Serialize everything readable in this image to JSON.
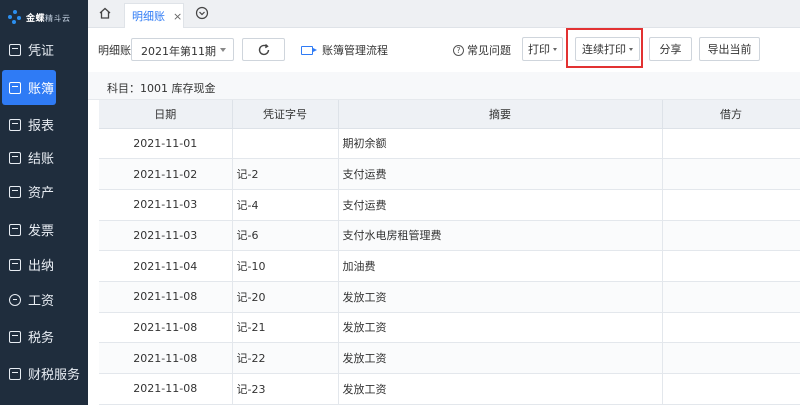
{
  "logo": {
    "name": "金蝶",
    "suffix": "精斗云"
  },
  "sidebar": {
    "items": [
      {
        "label": "凭证",
        "icon": "voucher-icon"
      },
      {
        "label": "账簿",
        "icon": "ledger-icon",
        "active": true
      },
      {
        "label": "报表",
        "icon": "report-icon"
      },
      {
        "label": "结账",
        "icon": "closing-icon"
      },
      {
        "label": "资产",
        "icon": "asset-icon"
      },
      {
        "label": "发票",
        "icon": "invoice-icon"
      },
      {
        "label": "出纳",
        "icon": "cashier-icon"
      },
      {
        "label": "工资",
        "icon": "salary-icon"
      },
      {
        "label": "税务",
        "icon": "tax-icon"
      },
      {
        "label": "财税服务",
        "icon": "service-icon"
      }
    ]
  },
  "tabs": {
    "active_label": "明细账",
    "close": "×"
  },
  "toolbar": {
    "ledger_label": "明细账",
    "period_value": "2021年第11期",
    "flow_link": "账簿管理流程",
    "faq_link": "常见问题",
    "print": "打印",
    "continuous_print": "连续打印",
    "share": "分享",
    "export_current": "导出当前"
  },
  "subject": {
    "text": "科目：1001 库存现金"
  },
  "table": {
    "headers": [
      "日期",
      "凭证字号",
      "摘要",
      "借方"
    ],
    "rows": [
      {
        "date": "2021-11-01",
        "voucher": "",
        "summary": "期初余额",
        "debit": ""
      },
      {
        "date": "2021-11-02",
        "voucher": "记-2",
        "summary": "支付运费",
        "debit": ""
      },
      {
        "date": "2021-11-03",
        "voucher": "记-4",
        "summary": "支付运费",
        "debit": ""
      },
      {
        "date": "2021-11-03",
        "voucher": "记-6",
        "summary": "支付水电房租管理费",
        "debit": ""
      },
      {
        "date": "2021-11-04",
        "voucher": "记-10",
        "summary": "加油费",
        "debit": ""
      },
      {
        "date": "2021-11-08",
        "voucher": "记-20",
        "summary": "发放工资",
        "debit": ""
      },
      {
        "date": "2021-11-08",
        "voucher": "记-21",
        "summary": "发放工资",
        "debit": ""
      },
      {
        "date": "2021-11-08",
        "voucher": "记-22",
        "summary": "发放工资",
        "debit": ""
      },
      {
        "date": "2021-11-08",
        "voucher": "记-23",
        "summary": "发放工资",
        "debit": ""
      }
    ]
  },
  "colors": {
    "sidebar_bg": "#1f2d3d",
    "accent": "#2f7bf5",
    "highlight": "#e23232"
  }
}
